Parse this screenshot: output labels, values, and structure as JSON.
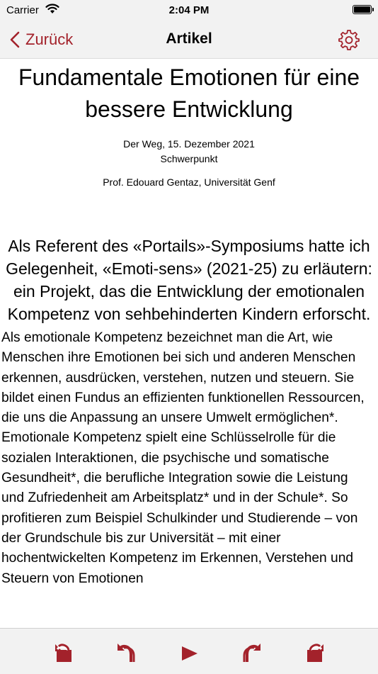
{
  "status_bar": {
    "carrier": "Carrier",
    "time": "2:04 PM"
  },
  "nav": {
    "back_label": "Zurück",
    "title": "Artikel",
    "accent_color": "#a3222b"
  },
  "article": {
    "title": "Fundamentale Emotionen für eine bessere Entwicklung",
    "source_date": "Der Weg, 15. Dezember 2021",
    "section": "Schwerpunkt",
    "author": "Prof. Edouard Gentaz, Universität Genf",
    "lead": "Als Referent des «Portails»-Symposiums hatte ich Gelegenheit, «Emoti-sens» (2021-25) zu erläutern: ein Projekt, das die Entwicklung der emotionalen Kompetenz von sehbehinderten Kindern erforscht.",
    "body": "Als emotionale Kompetenz bezeichnet man die Art, wie Menschen ihre Emotionen bei sich und anderen Menschen erkennen, ausdrücken, verstehen, nutzen und steuern. Sie bildet einen Fundus an effizienten funktionellen Ressourcen, die uns die Anpassung an unsere Umwelt ermöglichen*. Emotionale Kompetenz spielt eine Schlüsselrolle für die sozialen Interaktionen, die psychische und somatische Gesundheit*, die berufliche Integration sowie die Leistung und Zufriedenheit am Arbeitsplatz* und in der Schule*. So profitieren zum Beispiel Schulkinder und Studierende – von der Grundschule bis zur Universität – mit einer hochentwickelten Kompetenz im Erkennen, Verstehen und Steuern von Emotionen"
  },
  "toolbar": {
    "icons": [
      "jump-back-icon",
      "skip-back-icon",
      "play-icon",
      "skip-forward-icon",
      "jump-forward-icon"
    ]
  }
}
